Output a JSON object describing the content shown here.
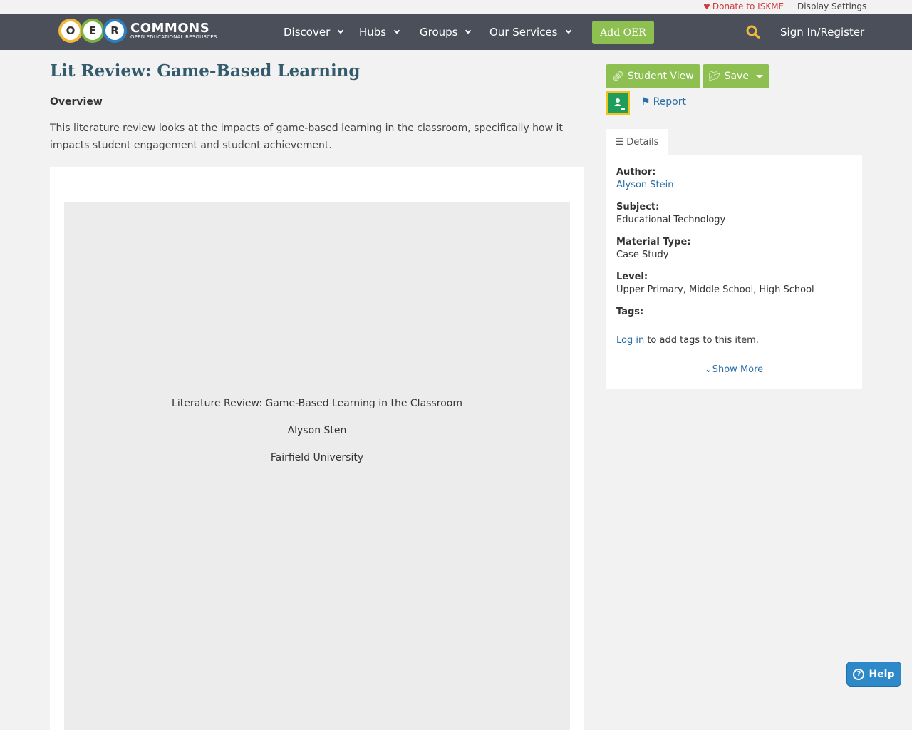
{
  "utility": {
    "donate_label": "Donate to ISKME",
    "display_settings_label": "Display Settings"
  },
  "nav": {
    "logo_letters": [
      "O",
      "E",
      "R"
    ],
    "logo_word": "COMMONS",
    "logo_sub": "OPEN EDUCATIONAL RESOURCES",
    "items": [
      {
        "label": "Discover"
      },
      {
        "label": "Hubs"
      },
      {
        "label": "Groups"
      },
      {
        "label": "Our Services"
      }
    ],
    "add_oer": "Add OER",
    "signin": "Sign In/Register"
  },
  "resource": {
    "title": "Lit Review: Game-Based Learning",
    "overview_label": "Overview",
    "overview_text": "This literature review looks at the impacts of game-based learning in the classroom, specifically how it impacts student engagement and student achievement.",
    "document": {
      "line1": "Literature Review: Game-Based Learning in the Classroom",
      "line2": "Alyson Sten",
      "line3": "Fairfield University"
    }
  },
  "actions": {
    "student_view": "Student View",
    "save": "Save",
    "report": "Report"
  },
  "details": {
    "tab_label": "Details",
    "author_label": "Author:",
    "author_value": "Alyson Stein",
    "subject_label": "Subject:",
    "subject_value": "Educational Technology",
    "material_label": "Material Type:",
    "material_value": "Case Study",
    "level_label": "Level:",
    "level_value": "Upper Primary, Middle School, High School",
    "tags_label": "Tags:",
    "login_link": "Log in",
    "login_suffix": " to add tags to this item.",
    "show_more": "Show More"
  },
  "help": {
    "label": "Help"
  },
  "colors": {
    "navbar": "#4a4f5a",
    "accent_green": "#8dc051",
    "title_blue": "#345a6e",
    "link_blue": "#2a6ea6",
    "donate_red": "#d23a3a",
    "search_yellow": "#f0b83c",
    "help_blue": "#2d89c8"
  }
}
